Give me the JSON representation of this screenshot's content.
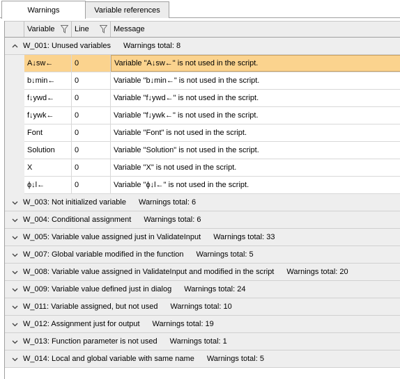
{
  "tabs": [
    {
      "label": "Warnings"
    },
    {
      "label": "Variable references"
    }
  ],
  "columns": {
    "variable": "Variable",
    "line": "Line",
    "message": "Message"
  },
  "expanded_group": {
    "title": "W_001: Unused variables",
    "count": "Warnings total:  8",
    "rows": [
      {
        "variable": "A↓sw←",
        "line": "0",
        "message": "Variable \"A↓sw←\" is not used in the script."
      },
      {
        "variable": "b↓min←",
        "line": "0",
        "message": "Variable \"b↓min←\" is not used in the script."
      },
      {
        "variable": "f↓ywd←",
        "line": "0",
        "message": "Variable \"f↓ywd←\" is not used in the script."
      },
      {
        "variable": "f↓ywk←",
        "line": "0",
        "message": "Variable \"f↓ywk←\" is not used in the script."
      },
      {
        "variable": "Font",
        "line": "0",
        "message": "Variable \"Font\" is not used in the script."
      },
      {
        "variable": "Solution",
        "line": "0",
        "message": "Variable \"Solution\" is not used in the script."
      },
      {
        "variable": "X",
        "line": "0",
        "message": "Variable \"X\" is not used in the script."
      },
      {
        "variable": "ϕ↓l←",
        "line": "0",
        "message": "Variable \"ϕ↓l←\" is not used in the script."
      }
    ]
  },
  "collapsed_groups": [
    {
      "title": "W_003: Not initialized variable",
      "count": "Warnings total:  6"
    },
    {
      "title": "W_004: Conditional assignment",
      "count": "Warnings total:  6"
    },
    {
      "title": "W_005: Variable value assigned just in ValidateInput",
      "count": "Warnings total:  33"
    },
    {
      "title": "W_007: Global variable modified in the function",
      "count": "Warnings total:  5"
    },
    {
      "title": "W_008: Variable value assigned in ValidateInput and modified in the script",
      "count": "Warnings total:  20"
    },
    {
      "title": "W_009: Variable value defined just in dialog",
      "count": "Warnings total:  24"
    },
    {
      "title": "W_011: Variable assigned, but not used",
      "count": "Warnings total:  10"
    },
    {
      "title": "W_012: Assignment just for output",
      "count": "Warnings total:  19"
    },
    {
      "title": "W_013: Function parameter is not used",
      "count": "Warnings total:  1"
    },
    {
      "title": "W_014: Local and global variable with same name",
      "count": "Warnings total:  5"
    }
  ],
  "colors": {
    "selected_row": "#fbd38e",
    "group_background": "#eeeeee"
  }
}
